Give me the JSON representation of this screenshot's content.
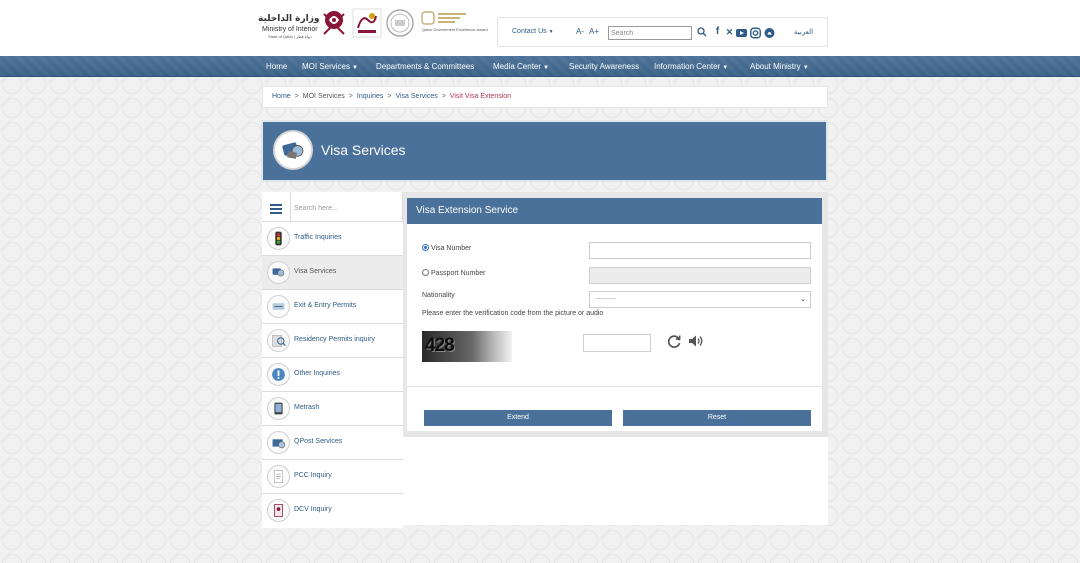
{
  "header": {
    "logo_ar": "وزارة الداخلية",
    "logo_en": "Ministry of Interior",
    "logo_sub": "State of Qatar | دولة قطر",
    "award_text": "Qatar Government Excellence Award",
    "contact_label": "Contact Us",
    "font_decrease": "A-",
    "font_increase": "A+",
    "search_placeholder": "Search",
    "arabic_link": "العربية",
    "social_icons": [
      "facebook-icon",
      "x-twitter-icon",
      "youtube-icon",
      "instagram-icon",
      "snapchat-icon"
    ]
  },
  "nav": {
    "items": [
      {
        "label": "Home",
        "has_caret": false
      },
      {
        "label": "MOI Services",
        "has_caret": true
      },
      {
        "label": "Departments & Committees",
        "has_caret": false
      },
      {
        "label": "Media Center",
        "has_caret": true
      },
      {
        "label": "Security Awareness",
        "has_caret": false
      },
      {
        "label": "Information Center",
        "has_caret": true
      },
      {
        "label": "About Ministry",
        "has_caret": true
      }
    ]
  },
  "breadcrumb": {
    "items": [
      "Home",
      "MOI Services",
      "Inquiries",
      "Visa Services"
    ],
    "current": "Visit Visa Extension",
    "separator": ">"
  },
  "banner": {
    "title": "Visa Services"
  },
  "sidebar": {
    "search_placeholder": "Search here...",
    "items": [
      {
        "label": "Traffic Inquiries",
        "icon": "traffic-light-icon",
        "active": false
      },
      {
        "label": "Visa Services",
        "icon": "visa-passport-icon",
        "active": true
      },
      {
        "label": "Exit & Entry Permits",
        "icon": "exit-entry-icon",
        "active": false
      },
      {
        "label": "Residency Permits inquiry",
        "icon": "residency-search-icon",
        "active": false
      },
      {
        "label": "Other Inquiries",
        "icon": "info-icon",
        "active": false
      },
      {
        "label": "Metrash",
        "icon": "metrash-phone-icon",
        "active": false
      },
      {
        "label": "QPost Services",
        "icon": "qpost-icon",
        "active": false
      },
      {
        "label": "PCC Inquiry",
        "icon": "pcc-document-icon",
        "active": false
      },
      {
        "label": "DCV Inquiry",
        "icon": "dcv-document-icon",
        "active": false
      }
    ]
  },
  "form": {
    "title": "Visa Extension Service",
    "visa_number_label": "Visa Number",
    "visa_number_value": "",
    "passport_number_label": "Passport Number",
    "passport_number_value": "",
    "nationality_label": "Nationality",
    "nationality_selected": "----------",
    "verification_instruction": "Please enter the verification code from the picture or audio",
    "captcha_text": "428",
    "captcha_input_value": "",
    "extend_button": "Extend",
    "reset_button": "Reset"
  },
  "colors": {
    "primary_blue": "#4a7199",
    "link_blue": "#2e5c87",
    "breadcrumb_current": "#b03a4e",
    "active_item_bg": "#ececec"
  }
}
